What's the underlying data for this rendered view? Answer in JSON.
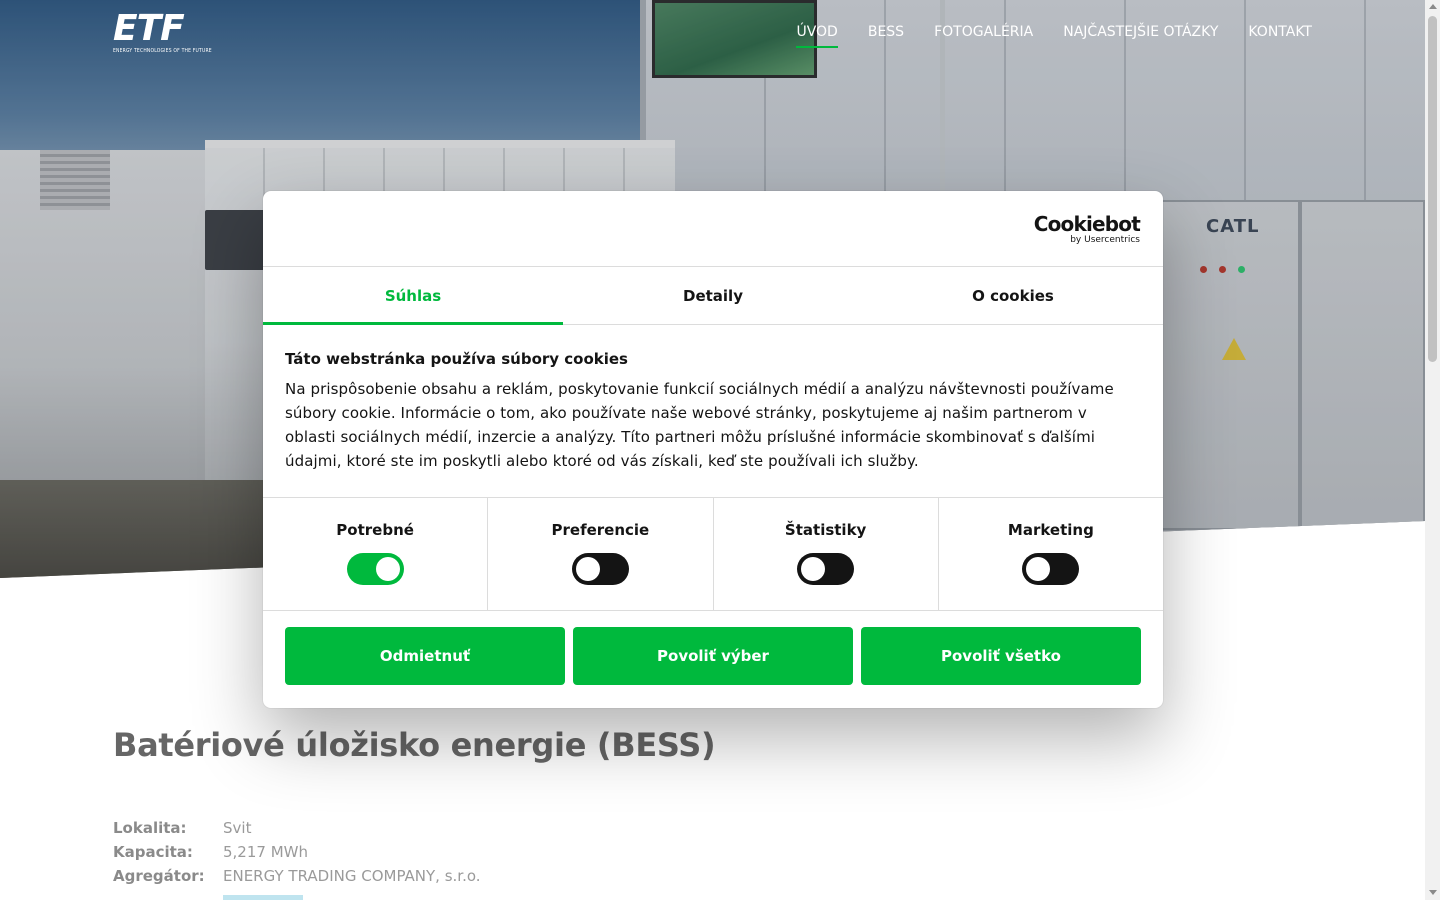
{
  "header": {
    "logo": {
      "mark": "ETF",
      "tagline": "ENERGY TECHNOLOGIES OF THE FUTURE"
    },
    "nav": [
      {
        "label": "ÚVOD",
        "active": true
      },
      {
        "label": "BESS",
        "active": false
      },
      {
        "label": "FOTOGALÉRIA",
        "active": false
      },
      {
        "label": "NAJČASTEJŠIE OTÁZKY",
        "active": false
      },
      {
        "label": "KONTAKT",
        "active": false
      }
    ]
  },
  "hero": {
    "cabinet_brand": "CATL"
  },
  "page": {
    "title": "Batériové úložisko energie (BESS)",
    "info": [
      {
        "label": "Lokalita:",
        "value": "Svit"
      },
      {
        "label": "Kapacita:",
        "value": "5,217 MWh"
      },
      {
        "label": "Agregátor:",
        "value": "ENERGY TRADING COMPANY, s.r.o."
      }
    ]
  },
  "cookie_dialog": {
    "brand": {
      "name": "Cookiebot",
      "sub": "by Usercentrics"
    },
    "tabs": [
      {
        "label": "Súhlas",
        "active": true
      },
      {
        "label": "Detaily",
        "active": false
      },
      {
        "label": "O cookies",
        "active": false
      }
    ],
    "heading": "Táto webstránka používa súbory cookies",
    "text": "Na prispôsobenie obsahu a reklám, poskytovanie funkcií sociálnych médií a analýzu návštevnosti používame súbory cookie. Informácie o tom, ako používate naše webové stránky, poskytujeme aj našim partnerom v oblasti sociálnych médií, inzercie a analýzy. Títo partneri môžu príslušné informácie skombinovať s ďalšími údajmi, ktoré ste im poskytli alebo ktoré od vás získali, keď ste používali ich služby.",
    "categories": [
      {
        "label": "Potrebné",
        "enabled": true
      },
      {
        "label": "Preferencie",
        "enabled": false
      },
      {
        "label": "Štatistiky",
        "enabled": false
      },
      {
        "label": "Marketing",
        "enabled": false
      }
    ],
    "buttons": {
      "decline": "Odmietnuť",
      "allow_selection": "Povoliť výber",
      "allow_all": "Povoliť všetko"
    }
  },
  "colors": {
    "accent_green": "#00b93d",
    "text_dark": "#141414",
    "title_gray": "#666666"
  }
}
